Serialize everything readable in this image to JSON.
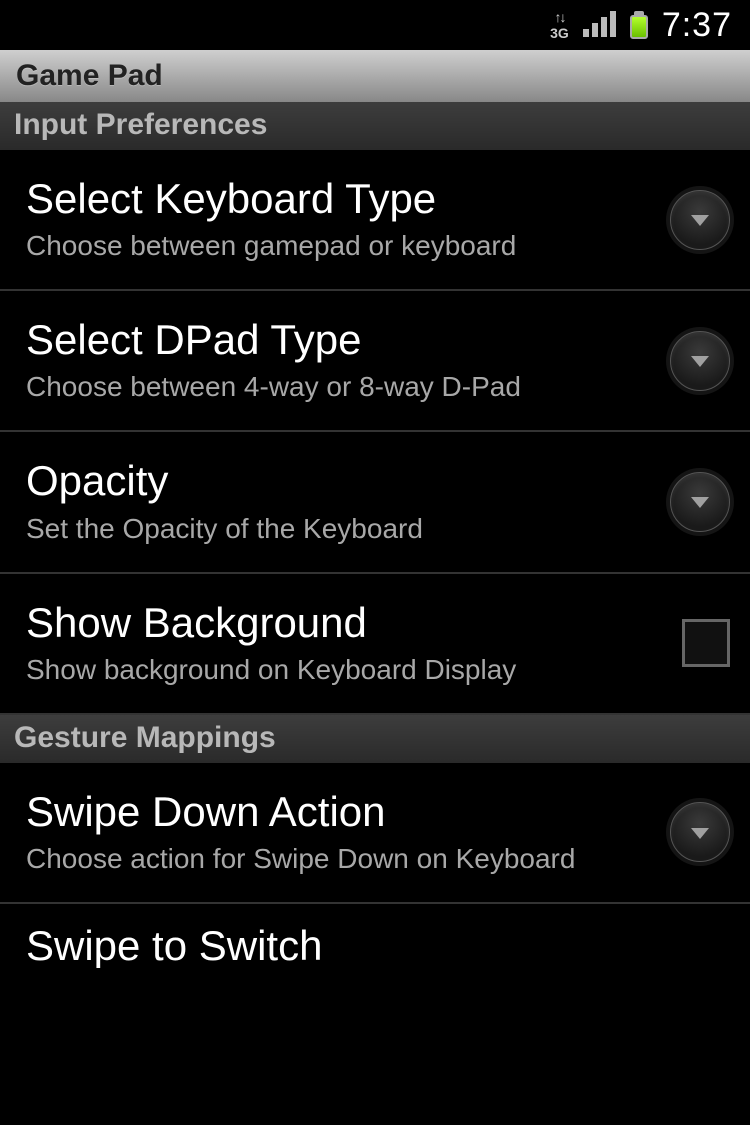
{
  "status_bar": {
    "network_type": "3G",
    "time": "7:37"
  },
  "title": "Game Pad",
  "sections": [
    {
      "header": "Input Preferences",
      "items": [
        {
          "title": "Select Keyboard Type",
          "summary": "Choose between gamepad or keyboard",
          "kind": "dropdown"
        },
        {
          "title": "Select DPad Type",
          "summary": "Choose between 4-way or 8-way D-Pad",
          "kind": "dropdown"
        },
        {
          "title": "Opacity",
          "summary": "Set the Opacity of the Keyboard",
          "kind": "dropdown"
        },
        {
          "title": "Show Background",
          "summary": "Show background on Keyboard Display",
          "kind": "checkbox",
          "checked": false
        }
      ]
    },
    {
      "header": "Gesture Mappings",
      "items": [
        {
          "title": "Swipe Down Action",
          "summary": "Choose action for Swipe Down on Keyboard",
          "kind": "dropdown"
        },
        {
          "title": "Swipe to Switch",
          "summary": "",
          "kind": "checkbox",
          "partial": true
        }
      ]
    }
  ]
}
